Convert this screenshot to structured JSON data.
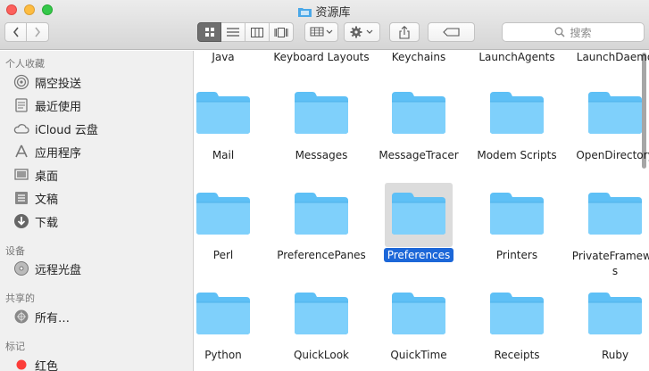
{
  "window": {
    "title": "资源库"
  },
  "toolbar": {
    "search_placeholder": "搜索",
    "back_icon": "chevron-left-icon",
    "forward_icon": "chevron-right-icon",
    "view_icons": [
      "icon-view-icon",
      "list-view-icon",
      "column-view-icon",
      "cover-flow-icon"
    ],
    "active_view": 0
  },
  "sidebar": {
    "sections": [
      {
        "title": "个人收藏",
        "items": [
          {
            "label": "隔空投送",
            "icon": "airdrop-icon"
          },
          {
            "label": "最近使用",
            "icon": "recents-icon"
          },
          {
            "label": "iCloud 云盘",
            "icon": "cloud-icon"
          },
          {
            "label": "应用程序",
            "icon": "applications-icon"
          },
          {
            "label": "桌面",
            "icon": "desktop-icon"
          },
          {
            "label": "文稿",
            "icon": "documents-icon"
          },
          {
            "label": "下载",
            "icon": "downloads-icon"
          }
        ]
      },
      {
        "title": "设备",
        "items": [
          {
            "label": "远程光盘",
            "icon": "disc-icon"
          }
        ]
      },
      {
        "title": "共享的",
        "items": [
          {
            "label": "所有…",
            "icon": "network-icon"
          }
        ]
      },
      {
        "title": "标记",
        "items": [
          {
            "label": "红色",
            "icon": "red-tag-icon",
            "color": "#fc3d39"
          }
        ]
      }
    ]
  },
  "content": {
    "top_row": [
      "Java",
      "Keyboard Layouts",
      "Keychains",
      "LaunchAgents",
      "LaunchDaemo"
    ],
    "rows": [
      [
        "Mail",
        "Messages",
        "MessageTracer",
        "Modem Scripts",
        "OpenDirectory"
      ],
      [
        "Perl",
        "PreferencePanes",
        "Preferences",
        "Printers",
        "PrivateFramewo s"
      ],
      [
        "Python",
        "QuickLook",
        "QuickTime",
        "Receipts",
        "Ruby"
      ]
    ],
    "selected": "Preferences",
    "folder_color": "#5ec0f6"
  }
}
